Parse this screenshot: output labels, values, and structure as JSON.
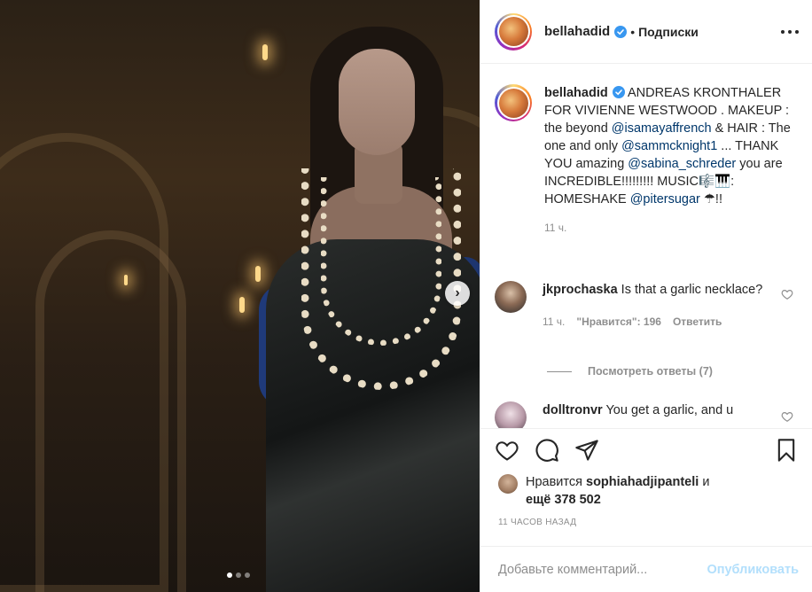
{
  "header": {
    "username": "bellahadid",
    "separator": "•",
    "follow_label": "Подписки"
  },
  "caption": {
    "username": "bellahadid",
    "text_1": "ANDREAS KRONTHALER FOR VIVIENNE WESTWOOD . MAKEUP : the beyond",
    "mention_1": "@isamayaffrench",
    "text_2": " & HAIR : The one and only ",
    "mention_2": "@sammcknight1",
    "text_3": " ... THANK YOU amazing ",
    "mention_3": "@sabina_schreder",
    "text_4": " you are INCREDIBLE!!!!!!!!! MUSIC🎼🎹: HOMESHAKE ",
    "mention_4": "@pitersugar",
    "text_5": " ☂!!",
    "time": "11 ч."
  },
  "comments": [
    {
      "username": "jkprochaska",
      "text": "Is that a garlic necklace?",
      "time": "11 ч.",
      "likes": "\"Нравится\": 196",
      "reply": "Ответить",
      "view_replies": "Посмотреть ответы (7)"
    },
    {
      "username": "dolltronvr",
      "text": "You get a garlic, and u"
    }
  ],
  "likes": {
    "prefix": "Нравится",
    "user": "sophiahadjipanteli",
    "conj": "и",
    "more": "ещё 378 502"
  },
  "post_time": "11 ЧАСОВ НАЗАД",
  "add_comment": {
    "placeholder": "Добавьте комментарий...",
    "publish_label": "Опубликовать"
  },
  "carousel": {
    "current": 1,
    "total": 3
  },
  "colors": {
    "link": "#00376b",
    "muted": "#8e8e8e",
    "publish_disabled": "#b2dffc",
    "verified": "#3897f0"
  }
}
